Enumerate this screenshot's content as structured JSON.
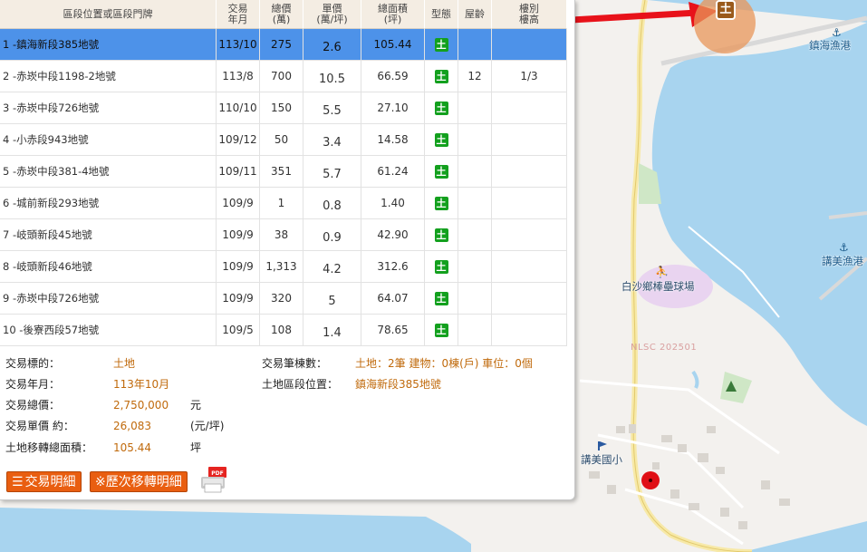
{
  "table": {
    "headers": [
      {
        "label": "區段位置或區段門牌"
      },
      {
        "label": "交易\n年月"
      },
      {
        "label": "總價\n(萬)"
      },
      {
        "label": "單價\n(萬/坪)"
      },
      {
        "label": "總面積\n(坪)"
      },
      {
        "label": "型態"
      },
      {
        "label": "屋齡"
      },
      {
        "label": "樓別\n樓高"
      }
    ],
    "rows": [
      {
        "addr": "1 -鎮海新段385地號",
        "date": "113/10",
        "total": "275",
        "unit": "2.6",
        "area": "105.44",
        "type": "土",
        "age": "",
        "floor": ""
      },
      {
        "addr": "2 -赤崁中段1198-2地號",
        "date": "113/8",
        "total": "700",
        "unit": "10.5",
        "area": "66.59",
        "type": "土",
        "age": "12",
        "floor": "1/3"
      },
      {
        "addr": "3 -赤崁中段726地號",
        "date": "110/10",
        "total": "150",
        "unit": "5.5",
        "area": "27.10",
        "type": "土",
        "age": "",
        "floor": ""
      },
      {
        "addr": "4 -小赤段943地號",
        "date": "109/12",
        "total": "50",
        "unit": "3.4",
        "area": "14.58",
        "type": "土",
        "age": "",
        "floor": ""
      },
      {
        "addr": "5 -赤崁中段381-4地號",
        "date": "109/11",
        "total": "351",
        "unit": "5.7",
        "area": "61.24",
        "type": "土",
        "age": "",
        "floor": ""
      },
      {
        "addr": "6 -城前新段293地號",
        "date": "109/9",
        "total": "1",
        "unit": "0.8",
        "area": "1.40",
        "type": "土",
        "age": "",
        "floor": ""
      },
      {
        "addr": "7 -岐頭新段45地號",
        "date": "109/9",
        "total": "38",
        "unit": "0.9",
        "area": "42.90",
        "type": "土",
        "age": "",
        "floor": ""
      },
      {
        "addr": "8 -岐頭新段46地號",
        "date": "109/9",
        "total": "1,313",
        "unit": "4.2",
        "area": "312.6",
        "type": "土",
        "age": "",
        "floor": ""
      },
      {
        "addr": "9 -赤崁中段726地號",
        "date": "109/9",
        "total": "320",
        "unit": "5",
        "area": "64.07",
        "type": "土",
        "age": "",
        "floor": ""
      },
      {
        "addr": "10 -後寮西段57地號",
        "date": "109/5",
        "total": "108",
        "unit": "1.4",
        "area": "78.65",
        "type": "土",
        "age": "",
        "floor": ""
      }
    ]
  },
  "detail": {
    "target_label": "交易標的：",
    "target_value": "土地",
    "date_label": "交易年月：",
    "date_value": "113年10月",
    "total_label": "交易總價：",
    "total_value": "2,750,000",
    "total_unit": "元",
    "unit_label": "交易單價 約：",
    "unit_value": "26,083",
    "unit_unit": "(元/坪)",
    "area_label": "土地移轉總面積：",
    "area_value": "105.44",
    "area_unit": "坪",
    "count_label": "交易筆棟數：",
    "count_value": "土地：2筆 建物：0棟(戶) 車位：0個",
    "location_label": "土地區段位置：",
    "location_value": "鎮海新段385地號"
  },
  "buttons": {
    "detail_label": "交易明細",
    "history_label": "※歷次移轉明細",
    "pdf_label": "PDF"
  },
  "map": {
    "marker_label": "土",
    "labels": {
      "harbor1": "鎮海漁港",
      "harbor2": "講美漁港",
      "field": "白沙鄉棒壘球場",
      "school": "講美國小",
      "watermark": "NLSC 202501"
    }
  },
  "colors": {
    "sea": "#a8d4ef",
    "accent": "#e95e10",
    "selected_row": "#4d92e9",
    "land_tag": "#13a01e",
    "value_text": "#c06a0c"
  }
}
